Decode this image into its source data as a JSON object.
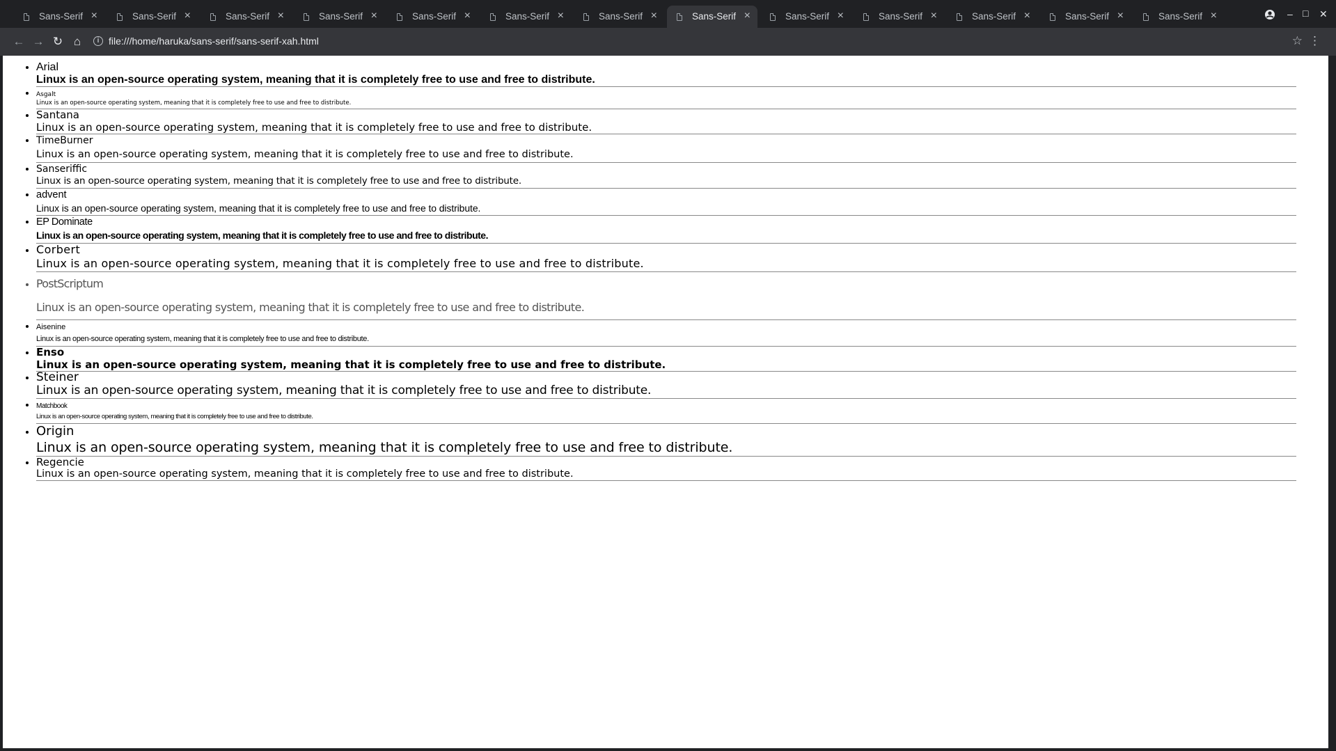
{
  "window": {
    "tabs": [
      {
        "title": "Sans-Serif",
        "active": false
      },
      {
        "title": "Sans-Serif",
        "active": false
      },
      {
        "title": "Sans-Serif",
        "active": false
      },
      {
        "title": "Sans-Serif",
        "active": false
      },
      {
        "title": "Sans-Serif",
        "active": false
      },
      {
        "title": "Sans-Serif",
        "active": false
      },
      {
        "title": "Sans-Serif",
        "active": false
      },
      {
        "title": "Sans-Serif",
        "active": true
      },
      {
        "title": "Sans-Serif",
        "active": false
      },
      {
        "title": "Sans-Serif",
        "active": false
      },
      {
        "title": "Sans-Serif",
        "active": false
      },
      {
        "title": "Sans-Serif",
        "active": false
      },
      {
        "title": "Sans-Serif",
        "active": false
      }
    ],
    "tab_close_glyph": "×",
    "profile_icon": "account-circle-icon",
    "minimize_glyph": "–",
    "maximize_glyph": "□",
    "close_glyph": "✕"
  },
  "toolbar": {
    "back_glyph": "←",
    "forward_glyph": "→",
    "reload_glyph": "↻",
    "home_glyph": "⌂",
    "info_glyph": "i",
    "url": "file:///home/haruka/sans-serif/sans-serif-xah.html",
    "star_glyph": "☆",
    "menu_glyph": "⋮"
  },
  "colors": {
    "chrome_bg": "#202124",
    "toolbar_bg": "#35363a",
    "page_bg": "#ffffff"
  },
  "fonts": [
    {
      "name": "Arial",
      "sample": "Linux is an open-source operating system, meaning that it is completely free to use and free to distribute."
    },
    {
      "name": "Asgalt",
      "sample": "Linux is an open-source operating system, meaning that it is completely free to use and free to distribute."
    },
    {
      "name": "Santana",
      "sample": "Linux is an open-source operating system, meaning that it is completely free to use and free to distribute."
    },
    {
      "name": "TimeBurner",
      "sample": "Linux is an open-source operating system, meaning that it is completely free to use and free to distribute."
    },
    {
      "name": "Sanseriffic",
      "sample": "Linux is an open-source operating system, meaning that it is completely free to use and free to distribute."
    },
    {
      "name": "advent",
      "sample": "Linux is an open-source operating system, meaning that it is completely free to use and free to distribute."
    },
    {
      "name": "EP Dominate",
      "sample": "Linux is an open-source operating system, meaning that it is completely free to use and free to distribute."
    },
    {
      "name": "Corbert",
      "sample": "Linux is an open-source operating system, meaning that it is completely free to use and free to distribute."
    },
    {
      "name": "PostScriptum",
      "sample": "Linux is an open-source operating system, meaning that it is completely free to use and free to distribute."
    },
    {
      "name": "Aisenine",
      "sample": "Linux is an open-source operating system, meaning that it is completely free to use and free to distribute."
    },
    {
      "name": "Enso",
      "sample": "Linux is an open-source operating system, meaning that it is completely free to use and free to distribute."
    },
    {
      "name": "Steiner",
      "sample": "Linux is an open-source operating system, meaning that it is completely free to use and free to distribute."
    },
    {
      "name": "Matchbook",
      "sample": "Linux is an open-source operating system, meaning that it is completely free to use and free to distribute."
    },
    {
      "name": "Origin",
      "sample": "Linux is an open-source operating system, meaning that it is completely free to use and free to distribute."
    },
    {
      "name": "Regencie",
      "sample": "Linux is an open-source operating system, meaning that it is completely free to use and free to distribute."
    }
  ]
}
